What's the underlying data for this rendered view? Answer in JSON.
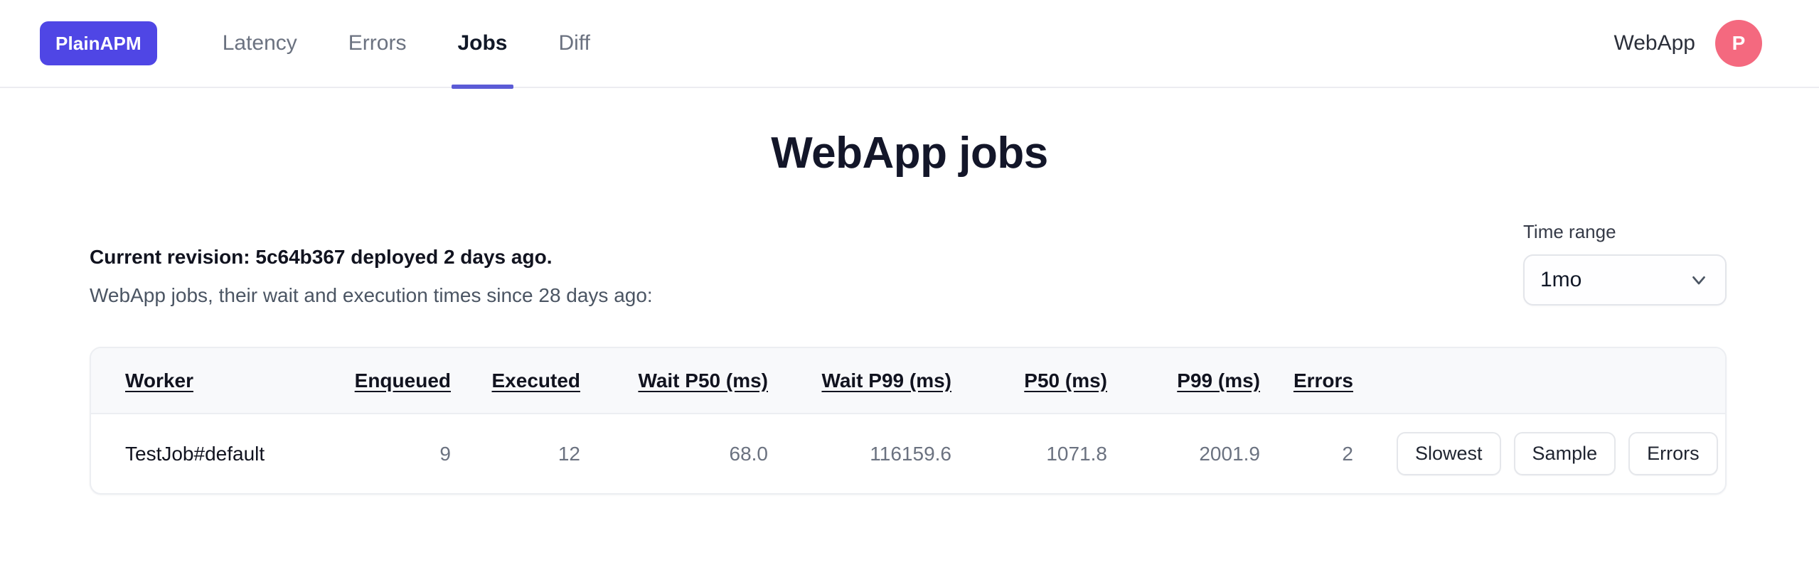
{
  "header": {
    "brand": "PlainAPM",
    "nav": [
      {
        "label": "Latency",
        "active": false
      },
      {
        "label": "Errors",
        "active": false
      },
      {
        "label": "Jobs",
        "active": true
      },
      {
        "label": "Diff",
        "active": false
      }
    ],
    "app_name": "WebApp",
    "avatar_initial": "P",
    "brand_color": "#4f46e5",
    "active_underline_color": "#5b5bd6",
    "avatar_color": "#f4697f"
  },
  "main": {
    "title": "WebApp jobs",
    "revision_line": "Current revision: 5c64b367 deployed 2 days ago.",
    "subtitle": "WebApp jobs, their wait and execution times since 28 days ago:",
    "time_range": {
      "label": "Time range",
      "value": "1mo",
      "options": [
        "1mo"
      ]
    },
    "table": {
      "columns": [
        "Worker",
        "Enqueued",
        "Executed",
        "Wait P50 (ms)",
        "Wait P99 (ms)",
        "P50 (ms)",
        "P99 (ms)",
        "Errors"
      ],
      "rows": [
        {
          "worker": "TestJob#default",
          "enqueued": "9",
          "executed": "12",
          "wait_p50": "68.0",
          "wait_p99": "116159.6",
          "p50": "1071.8",
          "p99": "2001.9",
          "errors": "2",
          "actions": [
            "Slowest",
            "Sample",
            "Errors"
          ]
        }
      ]
    }
  }
}
